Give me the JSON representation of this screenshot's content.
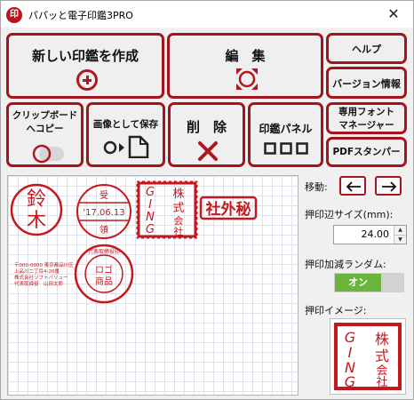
{
  "window": {
    "app_icon_text": "印",
    "title": "パパッと電子印鑑3PRO",
    "close_symbol": "✕"
  },
  "toolbar": {
    "create_label": "新しい印鑑を作成",
    "edit_label": "編　集",
    "help_label": "ヘルプ",
    "version_label": "バージョン情報",
    "clipboard_line1": "クリップボード",
    "clipboard_line2": "へコピー",
    "save_image_label": "画像として保存",
    "delete_label": "削　除",
    "panel_label": "印鑑パネル",
    "font_manager_line1": "専用フォント",
    "font_manager_line2": "マネージャー",
    "pdf_stamper_label": "PDFスタンパー"
  },
  "stamps": {
    "suzuki": {
      "chars": [
        "鈴",
        "木"
      ]
    },
    "date_stamp": {
      "top": "受",
      "date": "'17.06.13",
      "bottom": "領"
    },
    "company_square": {
      "chars": [
        "株",
        "式",
        "会",
        "社",
        "G",
        "I",
        "N",
        "G"
      ]
    },
    "shagai_hi": {
      "text": "社外秘"
    },
    "address_stamp": {
      "lines": [
        "〒000-0000 東京都品川区",
        "上品川二丁目4-20番",
        "株式会社ソフトバリュー",
        "代表取締役　山田太郎"
      ]
    },
    "circle_seal": {
      "ring_text": "代表取締役印",
      "center": [
        "ロゴ",
        "商品"
      ]
    }
  },
  "side": {
    "move_label": "移動:",
    "size_label": "押印辺サイズ(mm):",
    "size_value": "24.00",
    "random_label": "押印加減ランダム:",
    "toggle_label": "オン",
    "image_label": "押印イメージ:"
  },
  "colors": {
    "accent": "#a4141c",
    "stamp_red": "#c4181f",
    "toggle_green": "#6ab53c"
  },
  "icons": {
    "create": "circle-plus-icon",
    "edit": "target-frame-icon",
    "clipboard": "toggle-circle-icon",
    "save": "circle-arrow-document-icon",
    "delete": "x-mark-icon",
    "panel": "three-squares-icon",
    "move_left": "arrow-left-icon",
    "move_right": "arrow-right-icon"
  }
}
